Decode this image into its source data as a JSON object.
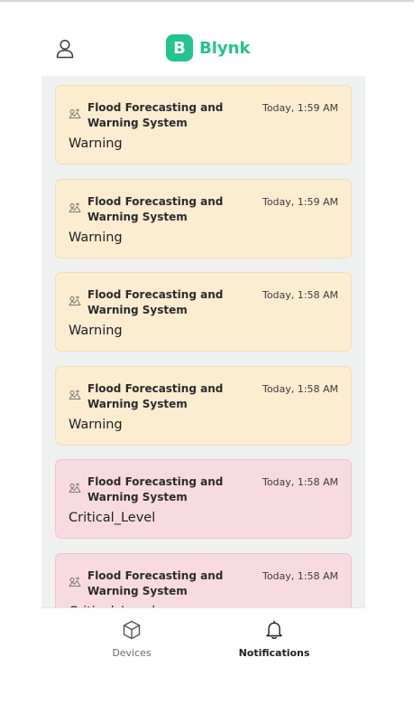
{
  "theme": {
    "brand": "#23c48e",
    "warning_bg": "#fcecd0",
    "warning_border": "#f2dcb2",
    "critical_bg": "#f8dbe0",
    "critical_border": "#eec3cb",
    "tab_active": "#1f1f1f",
    "tab_inactive": "#6b6b6b"
  },
  "header": {
    "user_icon": "user-icon",
    "logo_letter": "B",
    "app_name": "Blynk"
  },
  "notifications": [
    {
      "title": "Flood Forecasting and Warning System",
      "time": "Today, 1:59 AM",
      "message": "Warning",
      "level": "warning",
      "icon": "device-icon"
    },
    {
      "title": "Flood Forecasting and Warning System",
      "time": "Today, 1:59 AM",
      "message": "Warning",
      "level": "warning",
      "icon": "device-icon"
    },
    {
      "title": "Flood Forecasting and Warning System",
      "time": "Today, 1:58 AM",
      "message": "Warning",
      "level": "warning",
      "icon": "device-icon"
    },
    {
      "title": "Flood Forecasting and Warning System",
      "time": "Today, 1:58 AM",
      "message": "Warning",
      "level": "warning",
      "icon": "device-icon"
    },
    {
      "title": "Flood Forecasting and Warning System",
      "time": "Today, 1:58 AM",
      "message": "Critical_Level",
      "level": "critical",
      "icon": "device-icon"
    },
    {
      "title": "Flood Forecasting and Warning System",
      "time": "Today, 1:58 AM",
      "message": "Critical_Level",
      "level": "critical",
      "icon": "device-icon"
    }
  ],
  "tabbar": {
    "devices": {
      "label": "Devices",
      "icon": "cube-icon",
      "active": false
    },
    "notifications": {
      "label": "Notifications",
      "icon": "bell-icon",
      "active": true
    }
  }
}
